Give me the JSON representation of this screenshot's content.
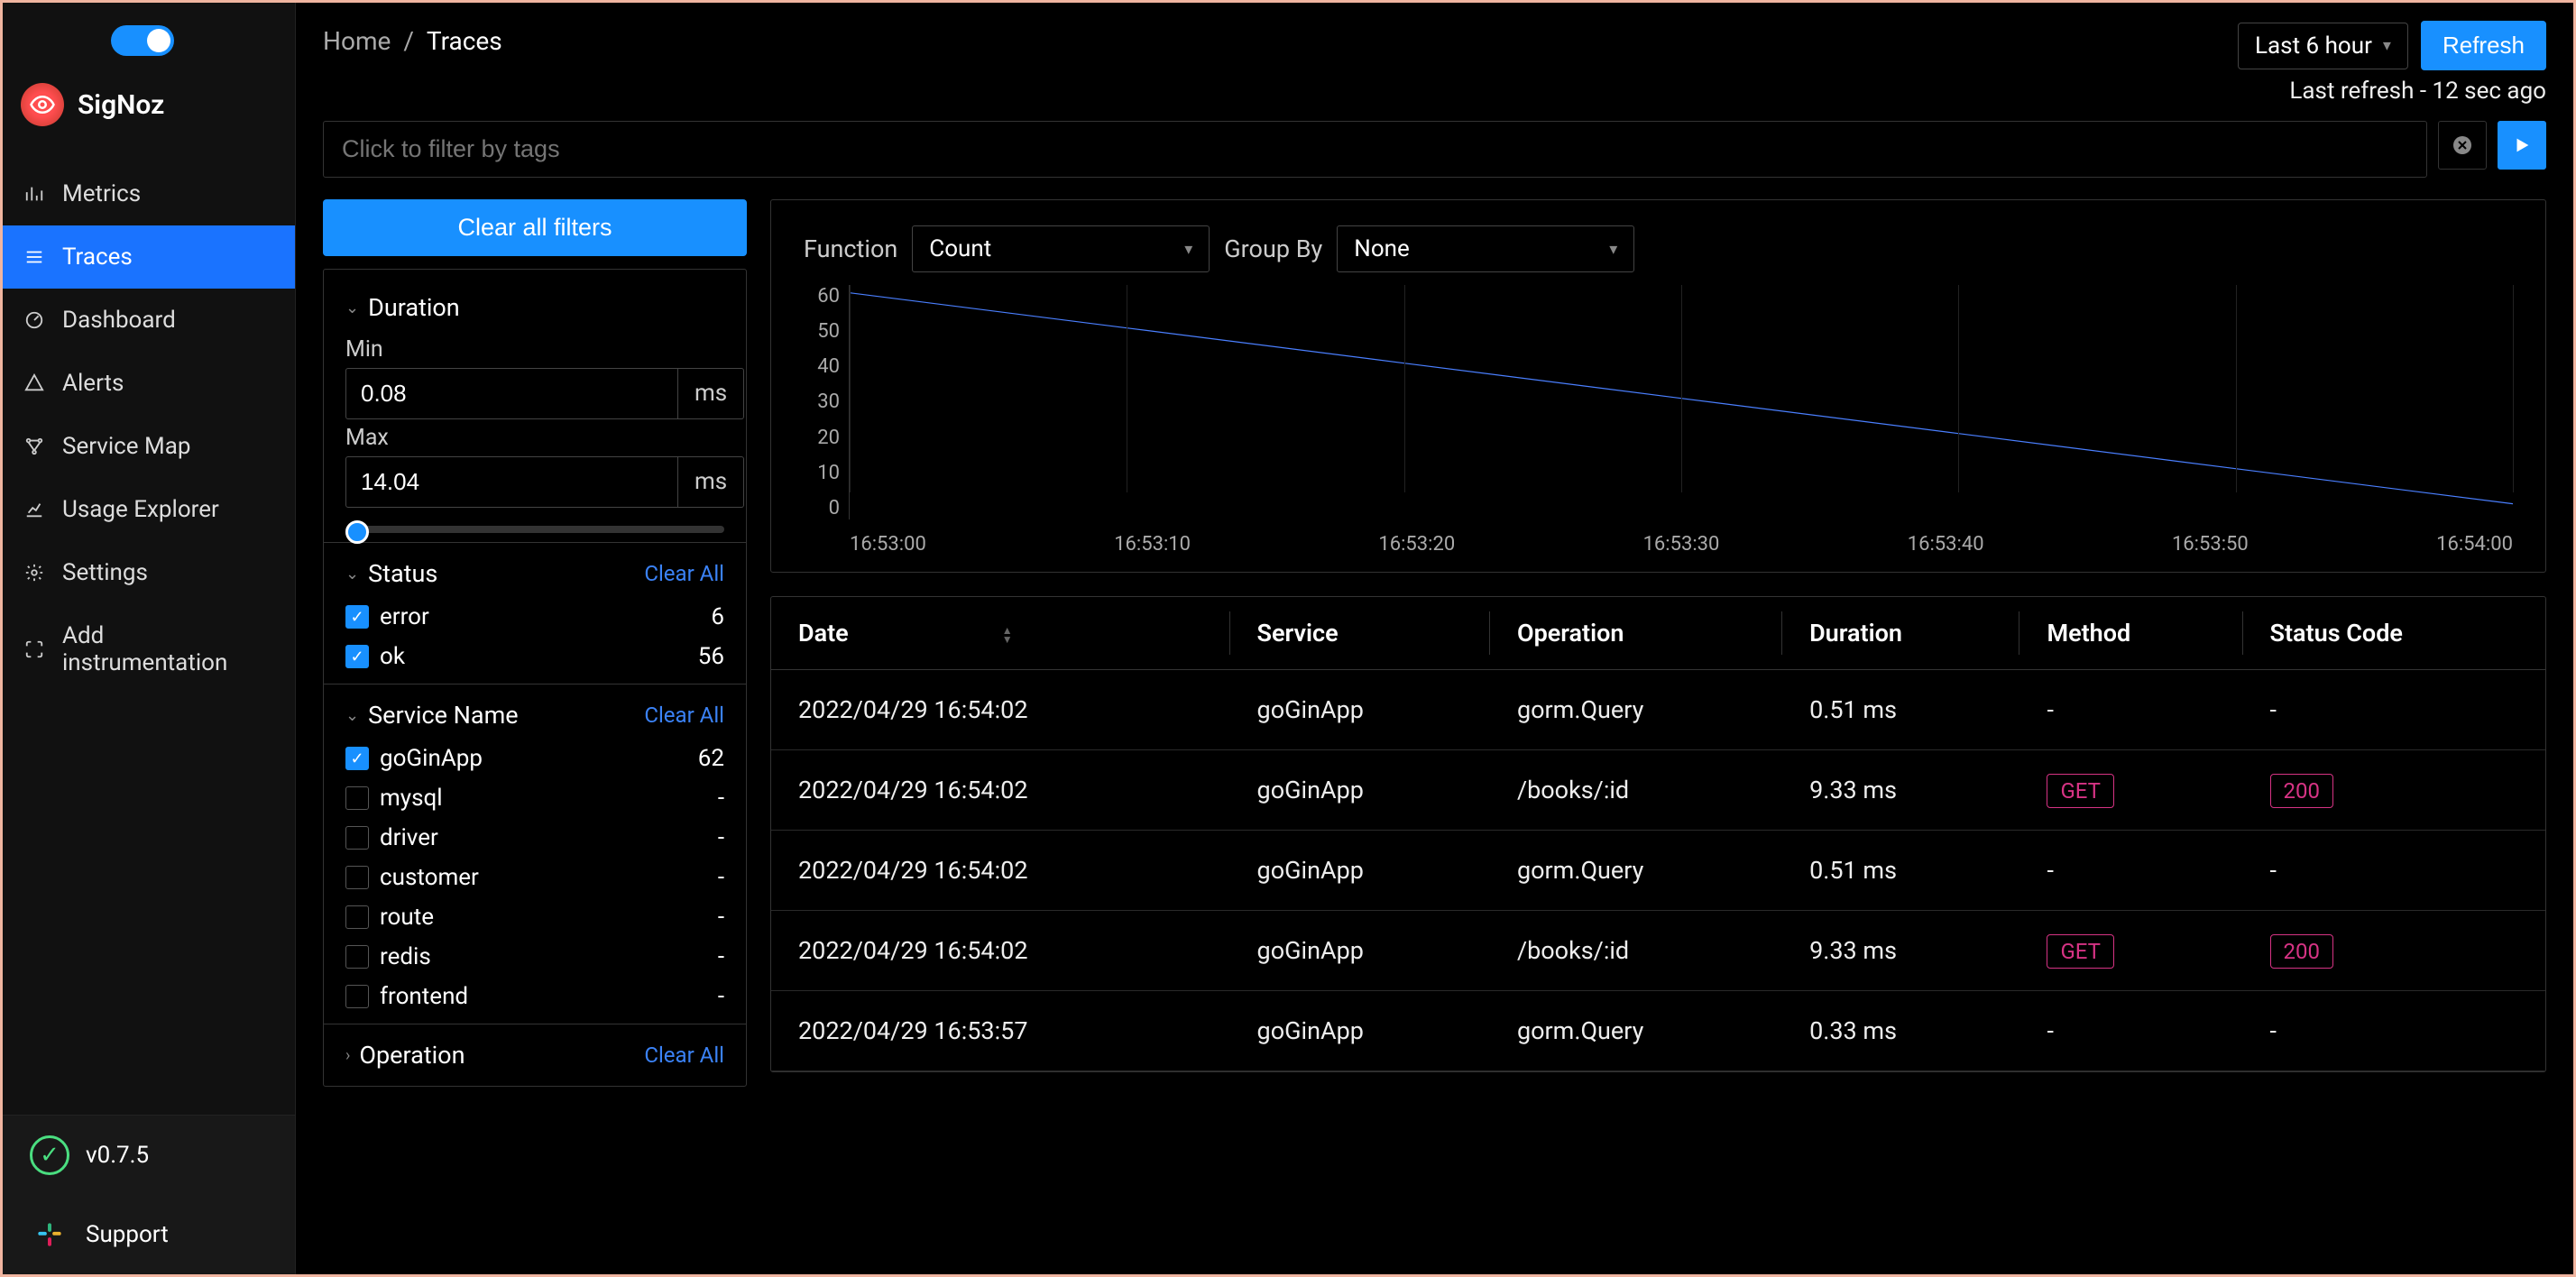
{
  "brand": "SigNoz",
  "nav": [
    {
      "id": "metrics",
      "label": "Metrics"
    },
    {
      "id": "traces",
      "label": "Traces"
    },
    {
      "id": "dashboard",
      "label": "Dashboard"
    },
    {
      "id": "alerts",
      "label": "Alerts"
    },
    {
      "id": "service-map",
      "label": "Service Map"
    },
    {
      "id": "usage-explorer",
      "label": "Usage Explorer"
    },
    {
      "id": "settings",
      "label": "Settings"
    },
    {
      "id": "add-instrumentation",
      "label": "Add instrumentation"
    }
  ],
  "sidebar_bottom": {
    "version": "v0.7.5",
    "support": "Support"
  },
  "breadcrumb": {
    "home": "Home",
    "sep": "/",
    "current": "Traces"
  },
  "time_range": {
    "value": "Last 6 hour"
  },
  "refresh_label": "Refresh",
  "last_refresh": "Last refresh - 12 sec ago",
  "filter_placeholder": "Click to filter by tags",
  "clear_all_filters": "Clear all filters",
  "clear_all_link": "Clear All",
  "filters": {
    "duration": {
      "title": "Duration",
      "min_label": "Min",
      "max_label": "Max",
      "min": "0.08",
      "max": "14.04",
      "unit": "ms"
    },
    "status": {
      "title": "Status",
      "items": [
        {
          "label": "error",
          "count": "6",
          "checked": true
        },
        {
          "label": "ok",
          "count": "56",
          "checked": true
        }
      ]
    },
    "service": {
      "title": "Service Name",
      "items": [
        {
          "label": "goGinApp",
          "count": "62",
          "checked": true
        },
        {
          "label": "mysql",
          "count": "-",
          "checked": false
        },
        {
          "label": "driver",
          "count": "-",
          "checked": false
        },
        {
          "label": "customer",
          "count": "-",
          "checked": false
        },
        {
          "label": "route",
          "count": "-",
          "checked": false
        },
        {
          "label": "redis",
          "count": "-",
          "checked": false
        },
        {
          "label": "frontend",
          "count": "-",
          "checked": false
        }
      ]
    },
    "operation": {
      "title": "Operation"
    }
  },
  "chart_controls": {
    "function_label": "Function",
    "function_value": "Count",
    "groupby_label": "Group By",
    "groupby_value": "None"
  },
  "chart_data": {
    "type": "line",
    "x": [
      "16:53:00",
      "16:53:10",
      "16:53:20",
      "16:53:30",
      "16:53:40",
      "16:53:50",
      "16:54:00"
    ],
    "y": [
      58,
      49,
      40,
      31,
      22,
      13,
      4
    ],
    "ylim": [
      0,
      60
    ],
    "y_ticks": [
      60,
      50,
      40,
      30,
      20,
      10,
      0
    ],
    "title": "",
    "xlabel": "",
    "ylabel": ""
  },
  "table": {
    "columns": [
      "Date",
      "Service",
      "Operation",
      "Duration",
      "Method",
      "Status Code"
    ],
    "rows": [
      {
        "date": "2022/04/29 16:54:02",
        "service": "goGinApp",
        "operation": "gorm.Query",
        "duration": "0.51 ms",
        "method": "-",
        "status": "-"
      },
      {
        "date": "2022/04/29 16:54:02",
        "service": "goGinApp",
        "operation": "/books/:id",
        "duration": "9.33 ms",
        "method": "GET",
        "status": "200"
      },
      {
        "date": "2022/04/29 16:54:02",
        "service": "goGinApp",
        "operation": "gorm.Query",
        "duration": "0.51 ms",
        "method": "-",
        "status": "-"
      },
      {
        "date": "2022/04/29 16:54:02",
        "service": "goGinApp",
        "operation": "/books/:id",
        "duration": "9.33 ms",
        "method": "GET",
        "status": "200"
      },
      {
        "date": "2022/04/29 16:53:57",
        "service": "goGinApp",
        "operation": "gorm.Query",
        "duration": "0.33 ms",
        "method": "-",
        "status": "-"
      }
    ]
  }
}
